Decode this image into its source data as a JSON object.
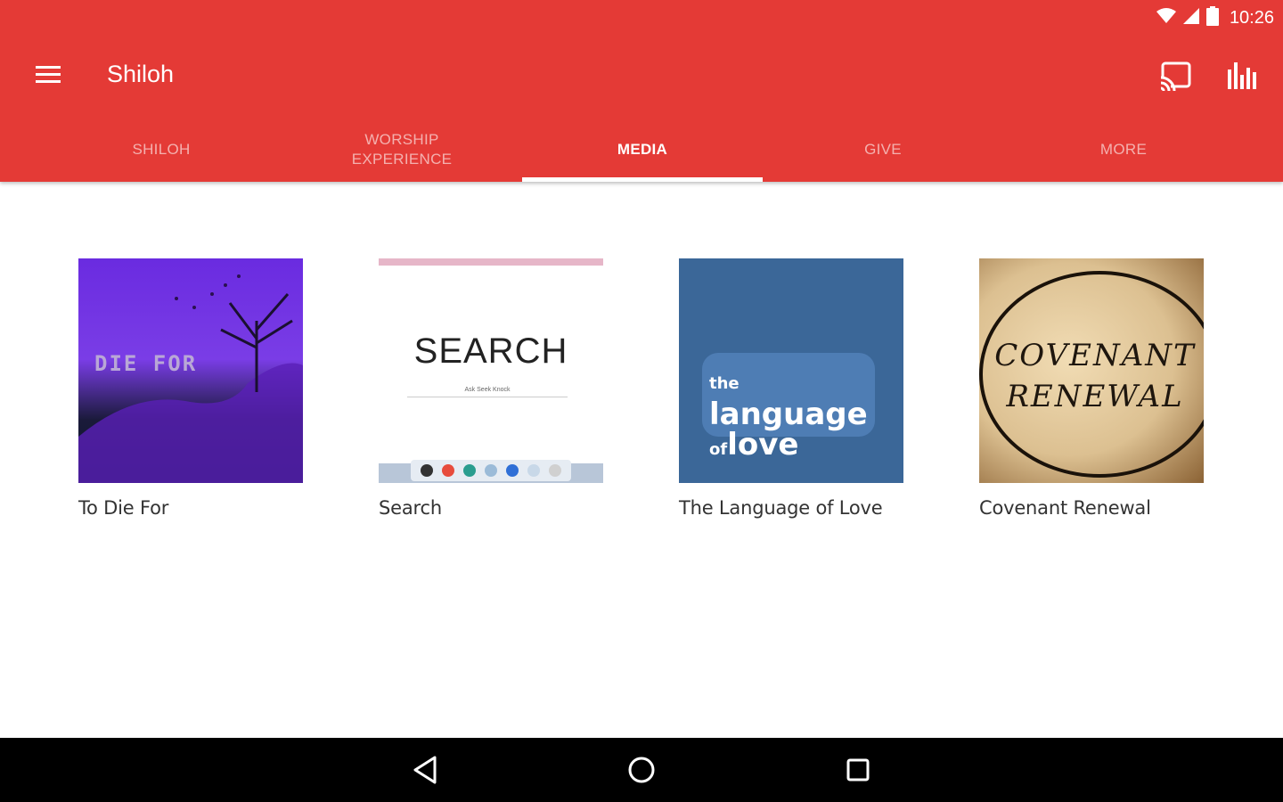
{
  "status_bar": {
    "time": "10:26"
  },
  "app_bar": {
    "title": "Shiloh"
  },
  "tabs": [
    {
      "label": "SHILOH",
      "active": false
    },
    {
      "label": "WORSHIP\nEXPERIENCE",
      "active": false
    },
    {
      "label": "MEDIA",
      "active": true
    },
    {
      "label": "GIVE",
      "active": false
    },
    {
      "label": "MORE",
      "active": false
    }
  ],
  "media": [
    {
      "title": "To Die For",
      "thumb_text": "DIE FOR"
    },
    {
      "title": "Search",
      "thumb_text": "SEARCH",
      "thumb_subtext": "Ask Seek Knock"
    },
    {
      "title": "The Language of Love",
      "thumb_text_1": "the",
      "thumb_text_2": "language",
      "thumb_text_3": "of",
      "thumb_text_4": "love"
    },
    {
      "title": "Covenant Renewal",
      "thumb_text_1": "COVENANT",
      "thumb_text_2": "RENEWAL"
    }
  ],
  "colors": {
    "primary": "#e43a36",
    "tab_indicator": "#ffffff",
    "nav_bar": "#000000"
  },
  "icons": [
    "signal-icon",
    "battery-icon",
    "menu-icon",
    "cast-icon",
    "equalizer-icon",
    "back-icon",
    "home-icon",
    "recents-icon"
  ]
}
